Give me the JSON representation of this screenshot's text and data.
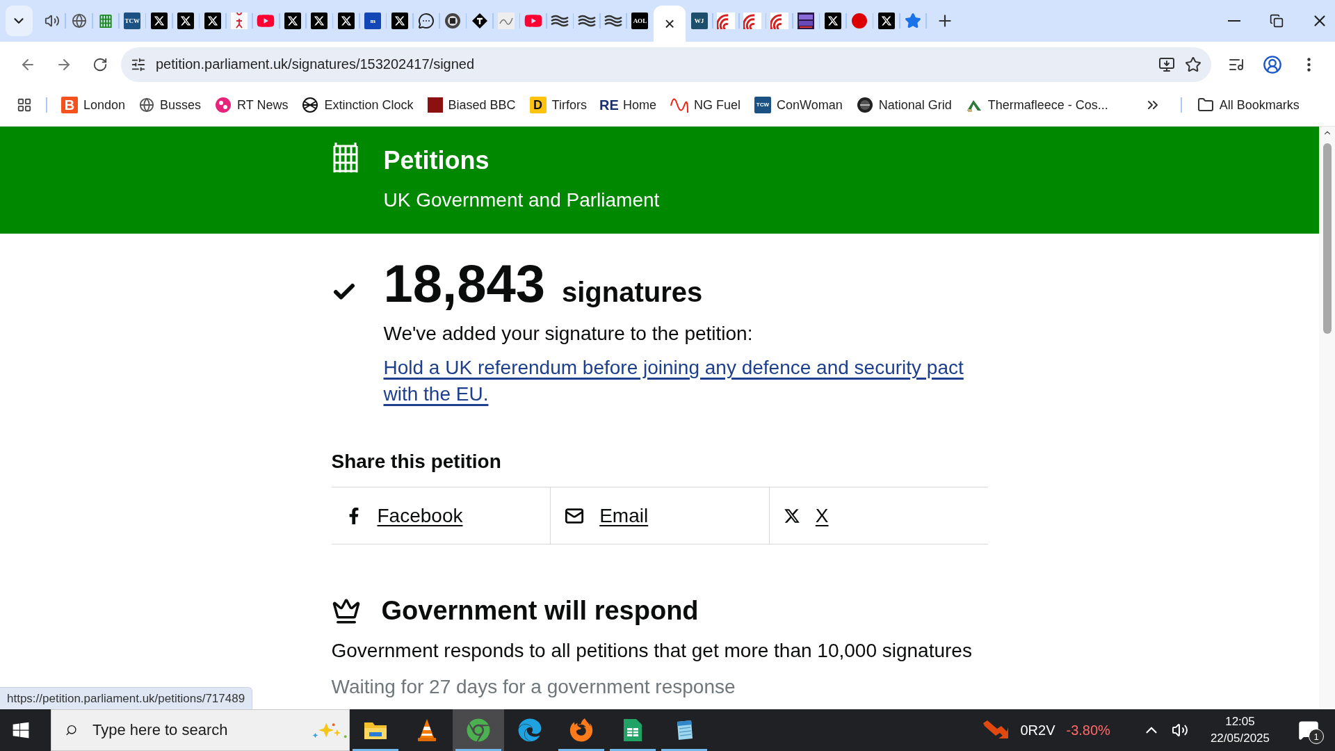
{
  "tabs": [
    {
      "kind": "speaker",
      "selected": false
    },
    {
      "kind": "globe",
      "selected": false
    },
    {
      "kind": "portcullis",
      "selected": false
    },
    {
      "kind": "logo",
      "glyph": "TCW",
      "color": "#1b5283",
      "selected": false
    },
    {
      "kind": "x",
      "selected": false
    },
    {
      "kind": "x",
      "selected": false
    },
    {
      "kind": "x",
      "selected": false
    },
    {
      "kind": "figure",
      "selected": false
    },
    {
      "kind": "youtube",
      "selected": false
    },
    {
      "kind": "x",
      "selected": false
    },
    {
      "kind": "x",
      "selected": false
    },
    {
      "kind": "x",
      "selected": false
    },
    {
      "kind": "logo",
      "glyph": "m",
      "color": "#1148b5",
      "selected": false
    },
    {
      "kind": "x",
      "selected": false
    },
    {
      "kind": "chat",
      "selected": false
    },
    {
      "kind": "record",
      "selected": false
    },
    {
      "kind": "diamond",
      "selected": false
    },
    {
      "kind": "sketch",
      "selected": false
    },
    {
      "kind": "youtube",
      "selected": false
    },
    {
      "kind": "waves",
      "selected": false
    },
    {
      "kind": "waves",
      "selected": false
    },
    {
      "kind": "waves",
      "selected": false
    },
    {
      "kind": "logo",
      "glyph": "AOL",
      "color": "#000000",
      "selected": false
    },
    {
      "kind": "active",
      "close": "×",
      "selected": true
    },
    {
      "kind": "logo",
      "glyph": "WJ",
      "color": "#1d4e6b",
      "selected": false
    },
    {
      "kind": "target",
      "selected": false
    },
    {
      "kind": "target",
      "selected": false
    },
    {
      "kind": "target",
      "selected": false
    },
    {
      "kind": "postal",
      "selected": false
    },
    {
      "kind": "x",
      "selected": false
    },
    {
      "kind": "dot",
      "selected": false
    },
    {
      "kind": "x",
      "selected": false
    },
    {
      "kind": "star",
      "selected": false
    }
  ],
  "address": "petition.parliament.uk/signatures/153202417/signed",
  "bookmarks": [
    {
      "kind": "logo",
      "glyph": "B",
      "color": "#f5511d",
      "label": "London"
    },
    {
      "kind": "globe",
      "label": "Busses"
    },
    {
      "kind": "rt",
      "label": "RT News"
    },
    {
      "kind": "extinction",
      "label": "Extinction Clock"
    },
    {
      "kind": "square",
      "color": "#8b1010",
      "label": "Biased BBC"
    },
    {
      "kind": "logo-light",
      "glyph": "D",
      "color": "#ffc20e",
      "label": "Tirfors"
    },
    {
      "kind": "logo-outline",
      "glyph": "RE",
      "color": "#1b2f6b",
      "label": "Home"
    },
    {
      "kind": "wave",
      "label": "NG Fuel"
    },
    {
      "kind": "logo",
      "glyph": "TCW",
      "color": "#1b5283",
      "label": "ConWoman"
    },
    {
      "kind": "dial",
      "label": "National Grid"
    },
    {
      "kind": "house",
      "label": "Thermafleece - Cos..."
    }
  ],
  "all_bookmarks": "All Bookmarks",
  "header": {
    "title": "Petitions",
    "subtitle": "UK Government and Parliament"
  },
  "signed": {
    "count": "18,843",
    "unit": "signatures",
    "message": "We've added your signature to the petition:",
    "petition_link": "Hold a UK referendum before joining any defence and security pact with the EU."
  },
  "share": {
    "heading": "Share this petition",
    "options": [
      {
        "kind": "facebook",
        "label": "Facebook"
      },
      {
        "kind": "email",
        "label": "Email"
      },
      {
        "kind": "x",
        "label": "X"
      }
    ]
  },
  "response": {
    "heading": "Government will respond",
    "text": "Government responds to all petitions that get more than 10,000 signatures",
    "waiting": "Waiting for 27 days for a government response"
  },
  "status_url": "https://petition.parliament.uk/petitions/717489",
  "taskbar": {
    "search_placeholder": "Type here to search",
    "apps": [
      {
        "kind": "explorer",
        "running": true,
        "selected": false
      },
      {
        "kind": "vlc",
        "running": false,
        "selected": false
      },
      {
        "kind": "chrome",
        "running": true,
        "selected": true
      },
      {
        "kind": "edge",
        "running": false,
        "selected": false
      },
      {
        "kind": "firefox",
        "running": true,
        "selected": false
      },
      {
        "kind": "sheets",
        "running": true,
        "selected": false
      },
      {
        "kind": "notepad",
        "running": true,
        "selected": false
      }
    ],
    "stock": {
      "symbol": "0R2V",
      "change": "-3.80%"
    },
    "time": "12:05",
    "date": "22/05/2025",
    "notifications": "1"
  }
}
